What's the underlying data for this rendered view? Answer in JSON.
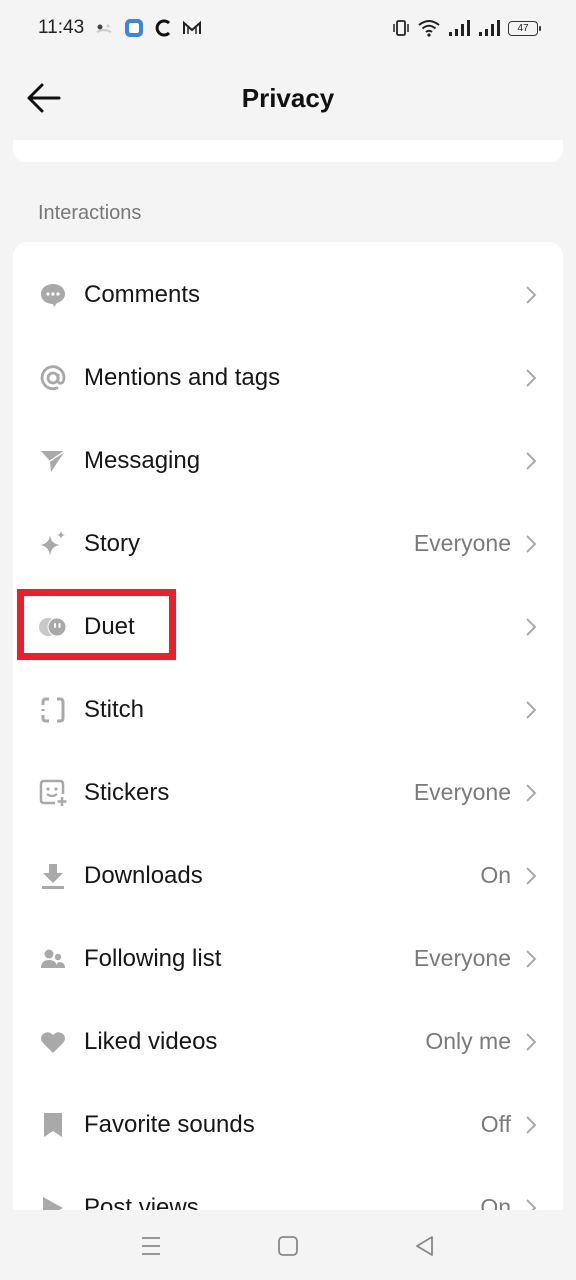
{
  "status_bar": {
    "time": "11:43",
    "notification_icons": [
      "app-notification-icon",
      "blue-square-app-icon",
      "c-app-icon",
      "gmail-icon"
    ],
    "system_icons": [
      "vibrate-icon",
      "wifi-icon",
      "signal-icon",
      "signal-icon"
    ],
    "battery": "47"
  },
  "header": {
    "title": "Privacy",
    "back_icon": "arrow-left-icon"
  },
  "section": {
    "label": "Interactions"
  },
  "items": [
    {
      "label": "Comments",
      "value": "",
      "icon": "comment-bubble-icon"
    },
    {
      "label": "Mentions and tags",
      "value": "",
      "icon": "at-sign-icon"
    },
    {
      "label": "Messaging",
      "value": "",
      "icon": "send-icon"
    },
    {
      "label": "Story",
      "value": "Everyone",
      "icon": "sparkle-icon"
    },
    {
      "label": "Duet",
      "value": "",
      "icon": "duet-icon"
    },
    {
      "label": "Stitch",
      "value": "",
      "icon": "stitch-icon"
    },
    {
      "label": "Stickers",
      "value": "Everyone",
      "icon": "sticker-icon"
    },
    {
      "label": "Downloads",
      "value": "On",
      "icon": "download-icon"
    },
    {
      "label": "Following list",
      "value": "Everyone",
      "icon": "users-icon"
    },
    {
      "label": "Liked videos",
      "value": "Only me",
      "icon": "heart-icon"
    },
    {
      "label": "Favorite sounds",
      "value": "Off",
      "icon": "bookmark-icon"
    },
    {
      "label": "Post views",
      "value": "On",
      "icon": "play-icon"
    }
  ],
  "highlight": {
    "target": "Duet",
    "color": "#e8202c"
  },
  "nav_bar": {
    "buttons": [
      "menu-icon",
      "home-icon",
      "back-triangle-icon"
    ]
  }
}
